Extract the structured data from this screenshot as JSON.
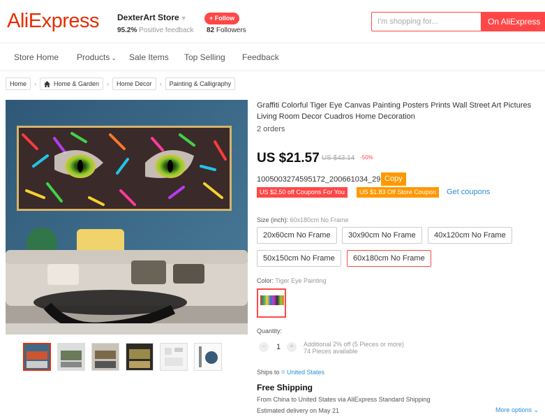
{
  "header": {
    "logo": "AliExpress",
    "store_name": "DexterArt Store",
    "feedback_pct": "95.2%",
    "feedback_label": "Positive feedback",
    "follow_label": "+ Follow",
    "followers_count": "82",
    "followers_label": "Followers",
    "search_placeholder": "I'm shopping for...",
    "search_button": "On AliExpress"
  },
  "nav": {
    "items": [
      "Store Home",
      "Products",
      "Sale Items",
      "Top Selling",
      "Feedback"
    ]
  },
  "breadcrumb": [
    "Home",
    "Home & Garden",
    "Home Decor",
    "Painting & Calligraphy"
  ],
  "product": {
    "title": "Graffiti Colorful Tiger Eye Canvas Painting Posters Prints Wall Street Art Pictures Living Room Decor Cuadros Home Decoration",
    "orders": "2 orders",
    "price": "US $21.57",
    "old_price": "US $43.14",
    "discount": "-50%",
    "sku": "1005003274595172_200661034_29",
    "copy_label": "Copy",
    "coupon1": "US $2.50 off Coupons For You",
    "coupon2": "US $1.83 Off Store Coupon",
    "get_coupons": "Get coupons",
    "size_label": "Size (inch):",
    "size_value": "60x180cm No Frame",
    "sizes": [
      "20x60cm No Frame",
      "30x90cm No Frame",
      "40x120cm No Frame",
      "50x150cm No Frame",
      "60x180cm No Frame"
    ],
    "color_label": "Color:",
    "color_value": "Tiger Eye Painting",
    "quantity_label": "Quantity:",
    "quantity": "1",
    "qty_note_1": "Additional 2% off (5 Pieces or more)",
    "qty_note_2": "74 Pieces available",
    "ships_to_label": "Ships to",
    "ships_to_value": "United States",
    "free_shipping": "Free Shipping",
    "ship_from": "From China to United States via AliExpress Standard Shipping",
    "delivery": "Estimated delivery on May 21",
    "more_options": "More options"
  },
  "colors": {
    "brand": "#e62e04",
    "accent": "#ff4747",
    "orange": "#ff9800",
    "link": "#2a8fd4"
  }
}
